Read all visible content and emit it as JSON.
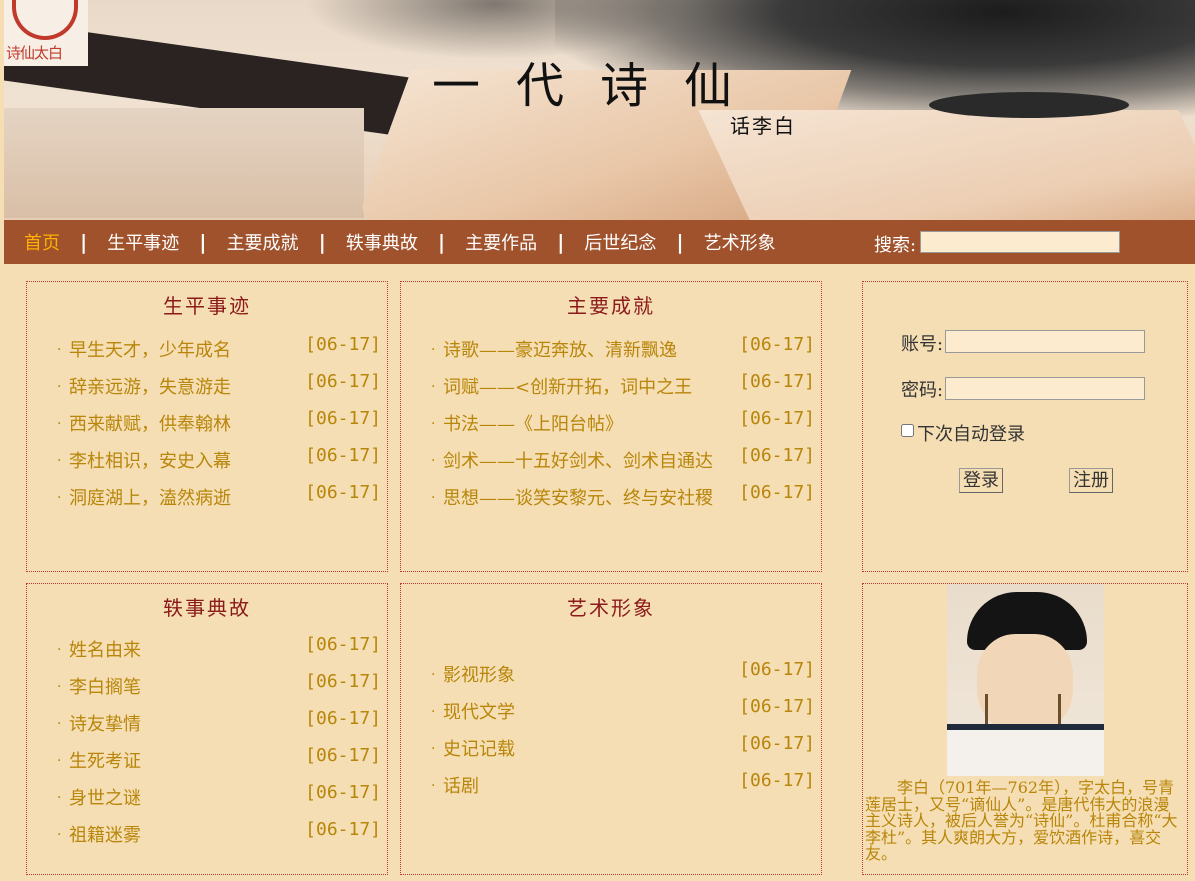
{
  "logo": {
    "text": "诗仙太白"
  },
  "banner": {
    "title": "一代诗仙",
    "subtitle": "话李白"
  },
  "nav": {
    "items": [
      "首页",
      "生平事迹",
      "主要成就",
      "轶事典故",
      "主要作品",
      "后世纪念",
      "艺术形象"
    ],
    "active_index": 0,
    "separator": "|",
    "search_label": "搜索:",
    "search_value": ""
  },
  "sections": {
    "life": {
      "title": "生平事迹",
      "items": [
        {
          "title": "早生天才，少年成名",
          "date": "[06-17]"
        },
        {
          "title": "辞亲远游，失意游走",
          "date": "[06-17]"
        },
        {
          "title": "西来献赋，供奉翰林",
          "date": "[06-17]"
        },
        {
          "title": "李杜相识，安史入幕",
          "date": "[06-17]"
        },
        {
          "title": "洞庭湖上，溘然病逝",
          "date": "[06-17]"
        }
      ]
    },
    "achievements": {
      "title": "主要成就",
      "items": [
        {
          "title": "诗歌——豪迈奔放、清新飘逸",
          "date": "[06-17]"
        },
        {
          "title": "词赋——<创新开拓，词中之王",
          "date": "[06-17]"
        },
        {
          "title": "书法——《上阳台帖》",
          "date": "[06-17]"
        },
        {
          "title": "剑术——十五好剑术、剑术自通达",
          "date": "[06-17]"
        },
        {
          "title": "思想——谈笑安黎元、终与安社稷",
          "date": "[06-17]"
        }
      ]
    },
    "anecdotes": {
      "title": "轶事典故",
      "items": [
        {
          "title": "姓名由来",
          "date": "[06-17]"
        },
        {
          "title": "李白搁笔",
          "date": "[06-17]"
        },
        {
          "title": "诗友挚情",
          "date": "[06-17]"
        },
        {
          "title": "生死考证",
          "date": "[06-17]"
        },
        {
          "title": "身世之谜",
          "date": "[06-17]"
        },
        {
          "title": "祖籍迷雾",
          "date": "[06-17]"
        }
      ]
    },
    "art": {
      "title": "艺术形象",
      "items": [
        {
          "title": "影视形象",
          "date": "[06-17]"
        },
        {
          "title": "现代文学",
          "date": "[06-17]"
        },
        {
          "title": "史记记载",
          "date": "[06-17]"
        },
        {
          "title": "话剧",
          "date": "[06-17]"
        }
      ]
    }
  },
  "login": {
    "account_label": "账号:",
    "account_value": "",
    "password_label": "密码:",
    "password_value": "",
    "remember_label": "下次自动登录",
    "remember_checked": false,
    "login_button": "登录",
    "register_button": "注册"
  },
  "bio": {
    "text": "李白（701年—762年），字太白，号青莲居士，又号“谪仙人”。是唐代伟大的浪漫主义诗人，被后人誉为“诗仙”。杜甫合称“大李杜”。其人爽朗大方，爱饮酒作诗，喜交友。"
  },
  "colors": {
    "background": "#f5deb3",
    "nav_background": "#a0522d",
    "nav_active": "#ffb000",
    "panel_title": "#8b1a1a",
    "link_text": "#b8860b"
  }
}
